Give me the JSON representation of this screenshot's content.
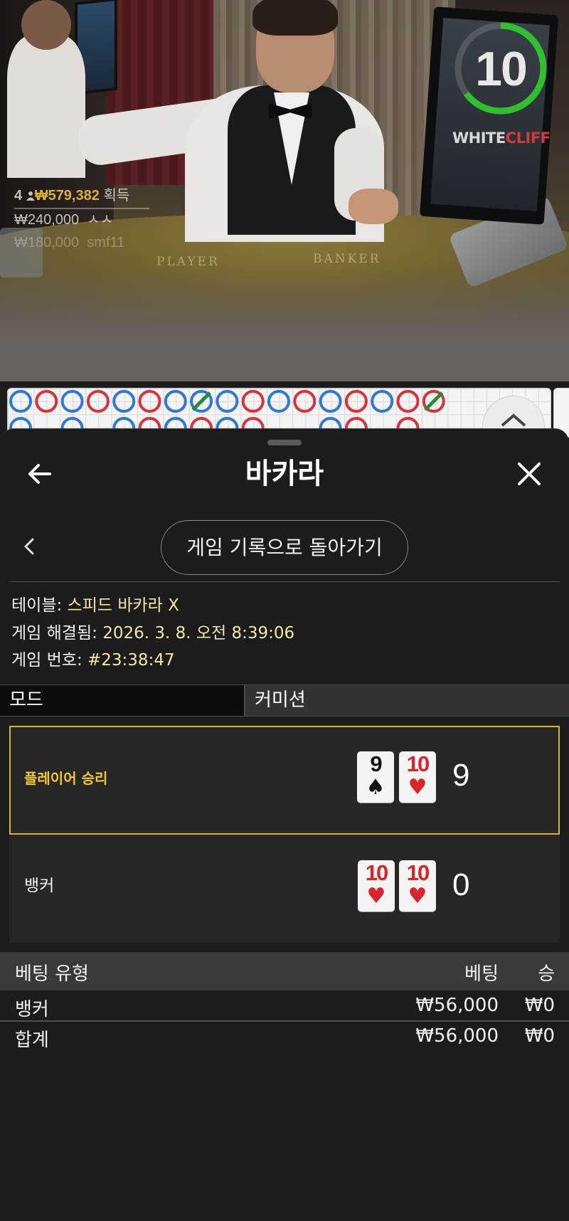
{
  "video": {
    "timer": "10",
    "brand": {
      "part1": "WHITE",
      "part2": "CLIFF"
    },
    "felt": {
      "player": "PLAYER",
      "banker": "BANKER"
    },
    "winners": [
      {
        "rank": "4",
        "amount": "₩579,382",
        "label": "획득"
      },
      {
        "amount": "₩240,000",
        "name": "ㅅㅅ"
      },
      {
        "amount": "₩180,000",
        "name": "smf11"
      }
    ],
    "colors": {
      "timer_ring": "#2ec02e",
      "winner_amount": "#d9b13a"
    }
  },
  "roadmap": {
    "top_row": [
      "P",
      "B",
      "P",
      "B",
      "P",
      "B",
      "P",
      "T",
      "P",
      "B",
      "P",
      "B",
      "P",
      "B",
      "P",
      "B",
      "T"
    ],
    "colors": {
      "player": "#2f78d4",
      "banker": "#d8323a",
      "tie": "#2a8a3a"
    },
    "expand_icon": "chevron-up-icon"
  },
  "header": {
    "title": "바카라",
    "back_icon": "arrow-left-icon",
    "close_icon": "close-icon"
  },
  "nav": {
    "back_label": "게임 기록으로 돌아가기"
  },
  "info": {
    "table_key": "테이블:",
    "table_val": "스피드 바카라 X",
    "resolved_key": "게임 해결됨:",
    "resolved_val": "2026. 3. 8. 오전 8:39:06",
    "number_key": "게임 번호:",
    "number_val": "#23:38:47"
  },
  "mode": {
    "left": "모드",
    "right": "커미션"
  },
  "results": {
    "player": {
      "label": "플레이어 승리",
      "cards": [
        {
          "rank": "9",
          "suit": "♠",
          "color": "black"
        },
        {
          "rank": "10",
          "suit": "♥",
          "color": "red"
        }
      ],
      "score": "9"
    },
    "banker": {
      "label": "뱅커",
      "cards": [
        {
          "rank": "10",
          "suit": "♥",
          "color": "red"
        },
        {
          "rank": "10",
          "suit": "♥",
          "color": "red"
        }
      ],
      "score": "0"
    }
  },
  "bets": {
    "headers": {
      "type": "베팅 유형",
      "bet": "베팅",
      "win": "승"
    },
    "rows": [
      {
        "type": "뱅커",
        "bet": "₩56,000",
        "win": "₩0"
      },
      {
        "type": "합계",
        "bet": "₩56,000",
        "win": "₩0"
      }
    ]
  }
}
